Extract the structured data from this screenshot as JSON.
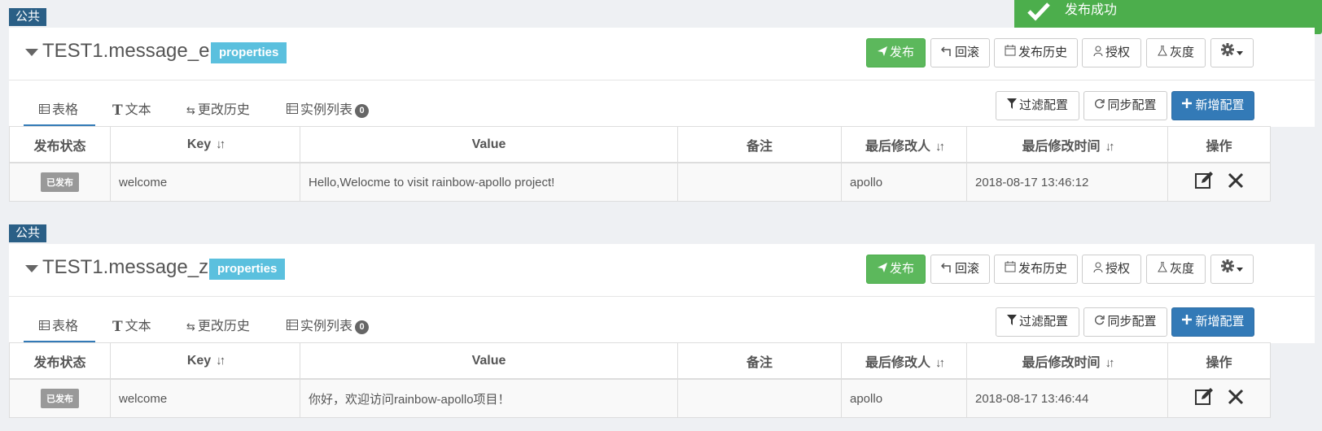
{
  "toast": {
    "text": "发布成功"
  },
  "namespaces": [
    {
      "badge": "公共",
      "title": "TEST1.message_en",
      "format": "properties",
      "actions": {
        "publish": "发布",
        "rollback": "回滚",
        "history": "发布历史",
        "grant": "授权",
        "gray": "灰度"
      },
      "tabs": {
        "table": "表格",
        "text": "文本",
        "history": "更改历史",
        "instances": "实例列表",
        "instances_count": "0"
      },
      "tools": {
        "filter": "过滤配置",
        "sync": "同步配置",
        "add": "新增配置"
      },
      "columns": [
        "发布状态",
        "Key",
        "Value",
        "备注",
        "最后修改人",
        "最后修改时间",
        "操作"
      ],
      "rows": [
        {
          "status": "已发布",
          "key": "welcome",
          "value": "Hello,Welocme to visit rainbow-apollo project!",
          "comment": "",
          "modifier": "apollo",
          "time": "2018-08-17 13:46:12"
        }
      ]
    },
    {
      "badge": "公共",
      "title": "TEST1.message_zh",
      "format": "properties",
      "actions": {
        "publish": "发布",
        "rollback": "回滚",
        "history": "发布历史",
        "grant": "授权",
        "gray": "灰度"
      },
      "tabs": {
        "table": "表格",
        "text": "文本",
        "history": "更改历史",
        "instances": "实例列表",
        "instances_count": "0"
      },
      "tools": {
        "filter": "过滤配置",
        "sync": "同步配置",
        "add": "新增配置"
      },
      "columns": [
        "发布状态",
        "Key",
        "Value",
        "备注",
        "最后修改人",
        "最后修改时间",
        "操作"
      ],
      "rows": [
        {
          "status": "已发布",
          "key": "welcome",
          "value": "你好，欢迎访问rainbow-apollo项目！",
          "comment": "",
          "modifier": "apollo",
          "time": "2018-08-17 13:46:44"
        }
      ]
    }
  ]
}
